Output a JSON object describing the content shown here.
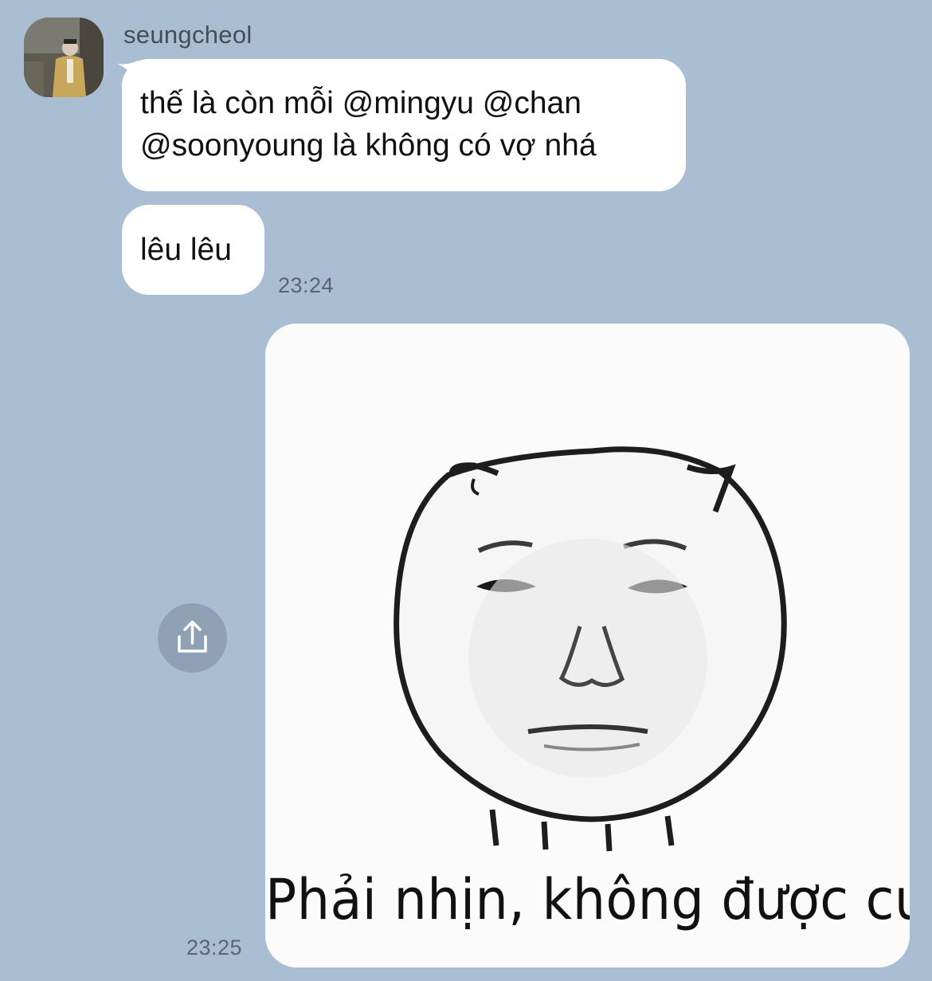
{
  "sender": {
    "name": "seungcheol"
  },
  "messages": [
    {
      "text_line1": "thế là còn mỗi @mingyu @chan",
      "text_line2": "@soonyoung là không có vợ nhá"
    },
    {
      "text": "lêu lêu",
      "time": "23:24"
    }
  ],
  "sticker": {
    "caption": "Phải nhịn, không được cười",
    "time": "23:25"
  },
  "share": {
    "icon": "share-icon"
  }
}
